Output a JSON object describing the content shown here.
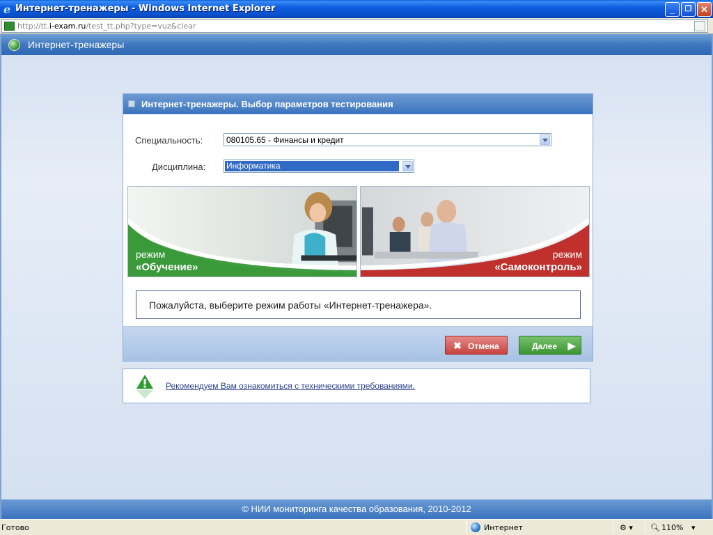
{
  "window": {
    "title": "Интернет-тренажеры - Windows Internet Explorer",
    "minimize": "_",
    "maximize": "❐",
    "close": "✕"
  },
  "address": {
    "url_prefix": "http://tt.",
    "url_domain": "i-exam.ru",
    "url_rest": "/test_tt.php?type=vuz&clear"
  },
  "app": {
    "header_title": "Интернет-тренажеры"
  },
  "panel": {
    "title": "Интернет-тренажеры. Выбор параметров тестирования",
    "specialty_label": "Специальность:",
    "specialty_value": "080105.65 - Финансы и кредит",
    "discipline_label": "Дисциплина:",
    "discipline_value": "Информатика",
    "mode_learning_line1": "режим",
    "mode_learning_line2": "«Обучение»",
    "mode_self_line1": "режим",
    "mode_self_line2": "«Самоконтроль»",
    "message": "Пожалуйста, выберите режим работы «Интернет-тренажера».",
    "cancel_label": "Отмена",
    "next_label": "Далее"
  },
  "tip": {
    "link_text": "Рекомендуем Вам ознакомиться с техническими требованиями."
  },
  "footer": {
    "copyright": "© НИИ мониторинга качества образования, 2010-2012"
  },
  "statusbar": {
    "status": "Готово",
    "zone": "Интернет",
    "zoom": "110%"
  },
  "colors": {
    "accent_blue": "#3b73bd",
    "learning_green": "#3a9a3a",
    "self_red": "#c0302c"
  }
}
